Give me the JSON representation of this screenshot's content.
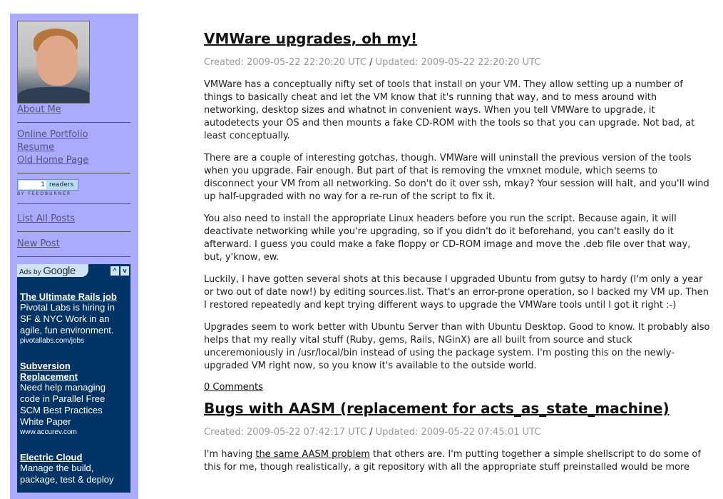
{
  "sidebar": {
    "about": "About Me",
    "portfolio": "Online Portfolio",
    "resume": "Resume",
    "old_home": "Old Home Page",
    "feedburner": {
      "count": "1",
      "readers": "readers",
      "by": "BY FEEDBURNER"
    },
    "list_posts": "List All Posts",
    "new_post": "New Post"
  },
  "ads": {
    "ads_by": "Ads by",
    "google": "Google",
    "prev": "^",
    "next": "v",
    "items": [
      {
        "title": "The Ultimate Rails job",
        "body": "Pivotal Labs is hiring in SF & NYC Work in an agile, fun environment.",
        "url": "pivotallabs.com/jobs"
      },
      {
        "title": "Subversion Replacement",
        "body": "Need help managing code in Parallel Free SCM Best Practices White Paper",
        "url": "www.accurev.com"
      },
      {
        "title": "Electric Cloud",
        "body": "Manage the build, package, test & deploy",
        "url": ""
      }
    ]
  },
  "posts": [
    {
      "title": "VMWare upgrades, oh my!",
      "created": "Created: 2009-05-22 22:20:20 UTC",
      "slash": "/",
      "updated": "Updated: 2009-05-22 22:20:20 UTC",
      "paragraphs": [
        "VMWare has a conceptually nifty set of tools that install on your VM. They allow setting up a number of things to basically cheat and let the VM know that it's running that way, and to mess around with networking, desktop sizes and whatnot in convenient ways. When you tell VMWare to upgrade, it autodetects your OS and then mounts a fake CD-ROM with the tools so that you can upgrade. Not bad, at least conceptually.",
        "There are a couple of interesting gotchas, though. VMWare will uninstall the previous version of the tools when you upgrade. Fair enough. But part of that is removing the vmxnet module, which seems to disconnect your VM from all networking. So don't do it over ssh, mkay? Your session will halt, and you'll wind up half-upgraded with no way for a re-run of the script to fix it.",
        "You also need to install the appropriate Linux headers before you run the script. Because again, it will deactivate networking while you're upgrading, so if you didn't do it beforehand, you can't easily do it afterward. I guess you could make a fake floppy or CD-ROM image and move the .deb file over that way, but, y'know, ew.",
        "Luckily, I have gotten several shots at this because I upgraded Ubuntu from gutsy to hardy (I'm only a year or two out of date now!) by editing sources.list. That's an error-prone operation, so I backed my VM up. Then I restored repeatedly and kept trying different ways to upgrade the VMWare tools until I got it right :-)",
        "Upgrades seem to work better with Ubuntu Server than with Ubuntu Desktop. Good to know. It probably also helps that my really vital stuff (Ruby, gems, Rails, NGinX) are all built from source and stuck unceremoniously in /usr/local/bin instead of using the package system. I'm posting this on the newly-upgraded VM right now, so you know it's available to the outside world."
      ],
      "comments": "0 Comments"
    },
    {
      "title": "Bugs with AASM (replacement for acts_as_state_machine)",
      "created": "Created: 2009-05-22 07:42:17 UTC",
      "slash": "/",
      "updated": "Updated: 2009-05-22 07:45:01 UTC",
      "intro_before": "I'm having ",
      "intro_link": "the same AASM problem",
      "intro_after": " that others are. I'm putting together a simple shellscript to do some of this for me, though realistically, a git repository with all the appropriate stuff preinstalled would be more"
    }
  ]
}
